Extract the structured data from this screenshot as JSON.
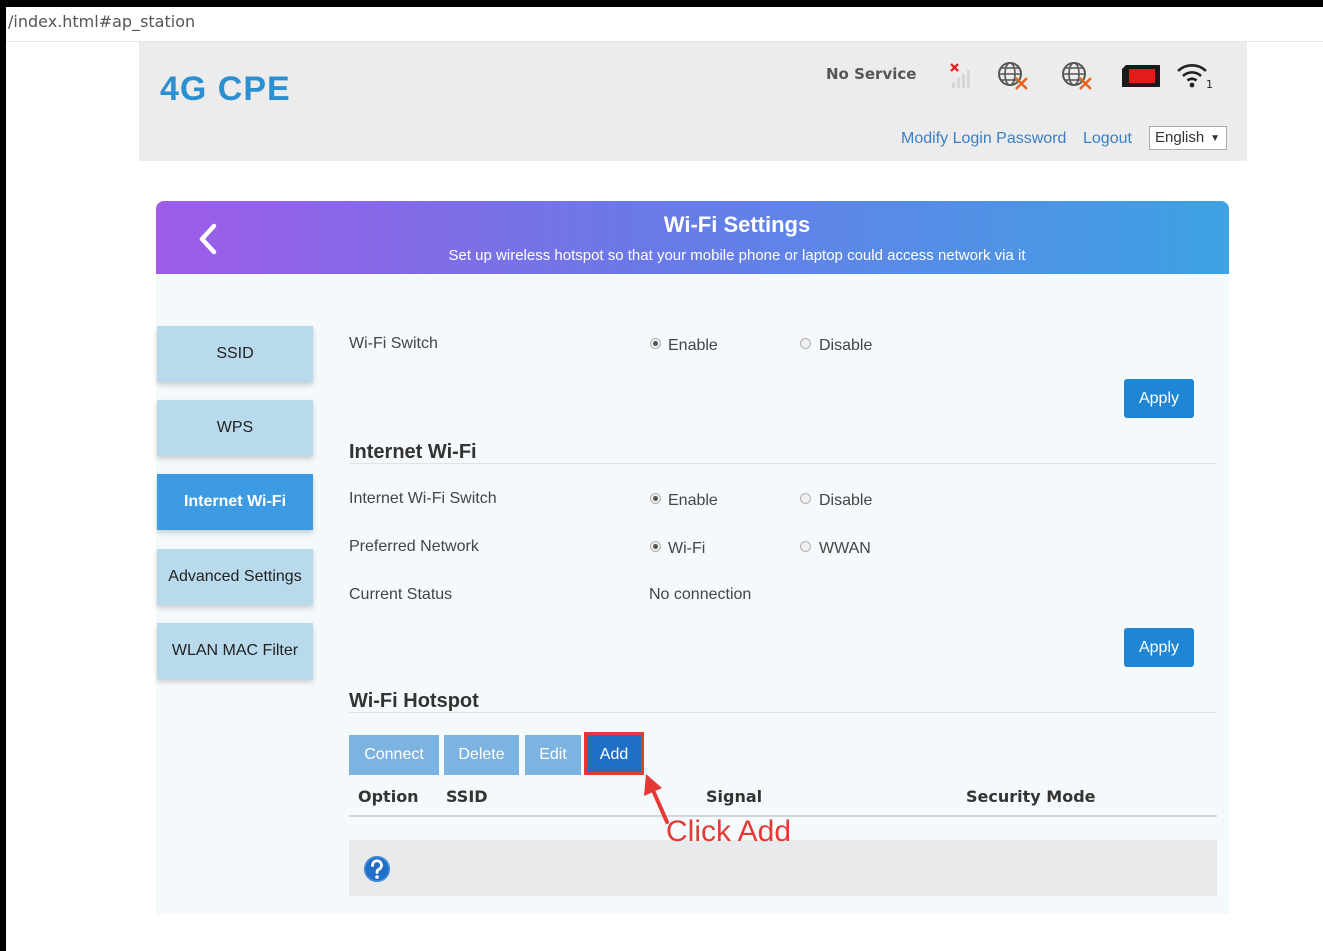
{
  "browser": {
    "url_fragment": "/index.html#ap_station"
  },
  "header": {
    "logo": "4G CPE",
    "network_status": "No Service",
    "links": {
      "modify_password": "Modify Login Password",
      "logout": "Logout"
    },
    "language": {
      "selected": "English"
    },
    "icons": [
      "signal-no-service-icon",
      "globe-disconnected-icon",
      "globe-disconnected-icon",
      "sim-card-icon",
      "wifi-icon"
    ],
    "wifi_clients": "1"
  },
  "banner": {
    "title": "Wi-Fi Settings",
    "subtitle": "Set up wireless hotspot so that your mobile phone or laptop could access network via it"
  },
  "sidebar": {
    "items": [
      {
        "label": "SSID"
      },
      {
        "label": "WPS"
      },
      {
        "label": "Internet Wi-Fi",
        "active": true
      },
      {
        "label": "Advanced Settings"
      },
      {
        "label": "WLAN MAC Filter"
      }
    ]
  },
  "wifi_switch": {
    "label": "Wi-Fi Switch",
    "options": [
      "Enable",
      "Disable"
    ],
    "selected": "Enable",
    "apply": "Apply"
  },
  "internet_wifi": {
    "title": "Internet Wi-Fi",
    "switch": {
      "label": "Internet Wi-Fi Switch",
      "options": [
        "Enable",
        "Disable"
      ],
      "selected": "Enable"
    },
    "preferred": {
      "label": "Preferred Network",
      "options": [
        "Wi-Fi",
        "WWAN"
      ],
      "selected": "Wi-Fi"
    },
    "status": {
      "label": "Current Status",
      "value": "No connection"
    },
    "apply": "Apply"
  },
  "hotspot": {
    "title": "Wi-Fi Hotspot",
    "buttons": {
      "connect": "Connect",
      "delete": "Delete",
      "edit": "Edit",
      "add": "Add"
    },
    "columns": [
      "Option",
      "SSID",
      "Signal",
      "Security Mode"
    ]
  },
  "annotation": {
    "text": "Click Add",
    "color": "#e53935"
  },
  "colors": {
    "accent": "#1f86d6",
    "logo": "#2b8fd1",
    "sidebar_active": "#3d9be3",
    "sidebar": "#b9d9ed"
  }
}
